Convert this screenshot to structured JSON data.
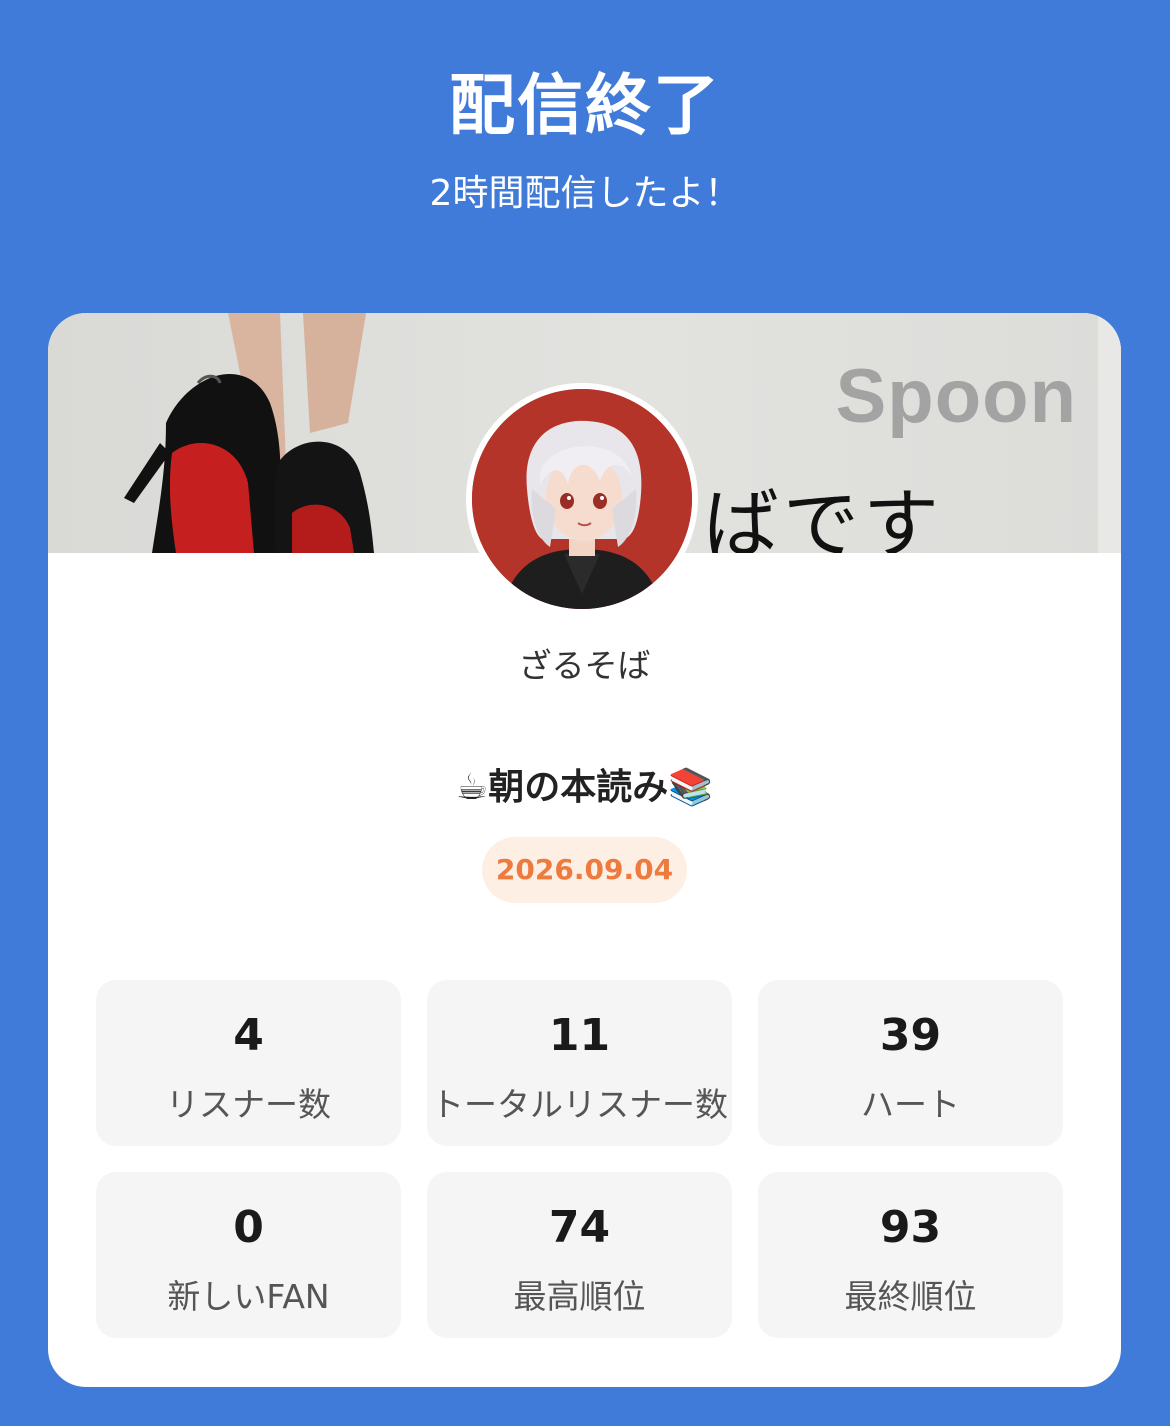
{
  "header": {
    "title": "配信終了",
    "subtitle": "2時間配信したよ！"
  },
  "banner": {
    "brand": "Spoon",
    "text": "ばです"
  },
  "profile": {
    "username": "ざるそば"
  },
  "broadcast": {
    "title": "☕朝の本読み📚",
    "date": "2026.09.04"
  },
  "stats": [
    {
      "value": "4",
      "label": "リスナー数"
    },
    {
      "value": "11",
      "label": "トータルリスナー数"
    },
    {
      "value": "39",
      "label": "ハート"
    },
    {
      "value": "0",
      "label": "新しいFAN"
    },
    {
      "value": "74",
      "label": "最高順位"
    },
    {
      "value": "93",
      "label": "最終順位"
    }
  ],
  "colors": {
    "background": "#417bd9",
    "card": "#ffffff",
    "date_badge_bg": "#fdefe4",
    "date_text": "#ee7a3d",
    "stat_bg": "#f5f5f5"
  }
}
